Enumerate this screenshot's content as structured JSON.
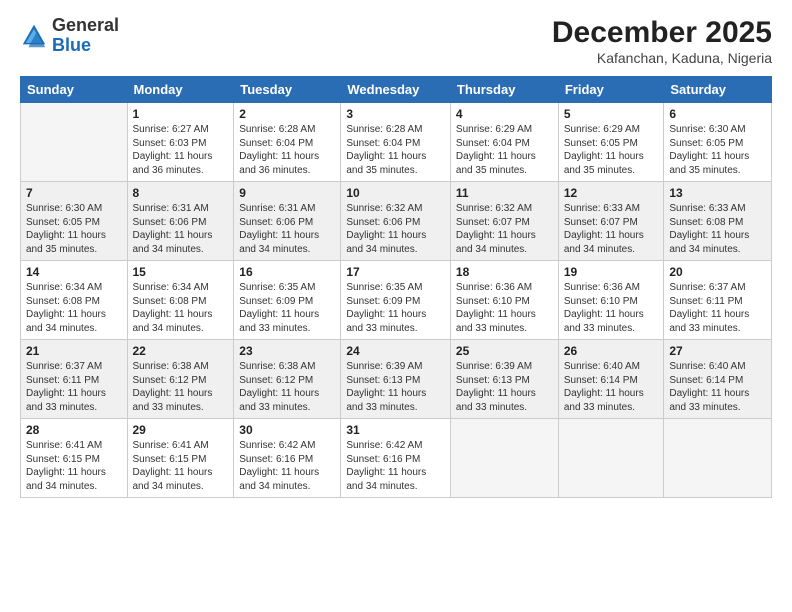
{
  "logo": {
    "general": "General",
    "blue": "Blue"
  },
  "header": {
    "month": "December 2025",
    "location": "Kafanchan, Kaduna, Nigeria"
  },
  "weekdays": [
    "Sunday",
    "Monday",
    "Tuesday",
    "Wednesday",
    "Thursday",
    "Friday",
    "Saturday"
  ],
  "weeks": [
    [
      {
        "day": "",
        "info": ""
      },
      {
        "day": "1",
        "info": "Sunrise: 6:27 AM\nSunset: 6:03 PM\nDaylight: 11 hours\nand 36 minutes."
      },
      {
        "day": "2",
        "info": "Sunrise: 6:28 AM\nSunset: 6:04 PM\nDaylight: 11 hours\nand 36 minutes."
      },
      {
        "day": "3",
        "info": "Sunrise: 6:28 AM\nSunset: 6:04 PM\nDaylight: 11 hours\nand 35 minutes."
      },
      {
        "day": "4",
        "info": "Sunrise: 6:29 AM\nSunset: 6:04 PM\nDaylight: 11 hours\nand 35 minutes."
      },
      {
        "day": "5",
        "info": "Sunrise: 6:29 AM\nSunset: 6:05 PM\nDaylight: 11 hours\nand 35 minutes."
      },
      {
        "day": "6",
        "info": "Sunrise: 6:30 AM\nSunset: 6:05 PM\nDaylight: 11 hours\nand 35 minutes."
      }
    ],
    [
      {
        "day": "7",
        "info": "Sunrise: 6:30 AM\nSunset: 6:05 PM\nDaylight: 11 hours\nand 35 minutes."
      },
      {
        "day": "8",
        "info": "Sunrise: 6:31 AM\nSunset: 6:06 PM\nDaylight: 11 hours\nand 34 minutes."
      },
      {
        "day": "9",
        "info": "Sunrise: 6:31 AM\nSunset: 6:06 PM\nDaylight: 11 hours\nand 34 minutes."
      },
      {
        "day": "10",
        "info": "Sunrise: 6:32 AM\nSunset: 6:06 PM\nDaylight: 11 hours\nand 34 minutes."
      },
      {
        "day": "11",
        "info": "Sunrise: 6:32 AM\nSunset: 6:07 PM\nDaylight: 11 hours\nand 34 minutes."
      },
      {
        "day": "12",
        "info": "Sunrise: 6:33 AM\nSunset: 6:07 PM\nDaylight: 11 hours\nand 34 minutes."
      },
      {
        "day": "13",
        "info": "Sunrise: 6:33 AM\nSunset: 6:08 PM\nDaylight: 11 hours\nand 34 minutes."
      }
    ],
    [
      {
        "day": "14",
        "info": "Sunrise: 6:34 AM\nSunset: 6:08 PM\nDaylight: 11 hours\nand 34 minutes."
      },
      {
        "day": "15",
        "info": "Sunrise: 6:34 AM\nSunset: 6:08 PM\nDaylight: 11 hours\nand 34 minutes."
      },
      {
        "day": "16",
        "info": "Sunrise: 6:35 AM\nSunset: 6:09 PM\nDaylight: 11 hours\nand 33 minutes."
      },
      {
        "day": "17",
        "info": "Sunrise: 6:35 AM\nSunset: 6:09 PM\nDaylight: 11 hours\nand 33 minutes."
      },
      {
        "day": "18",
        "info": "Sunrise: 6:36 AM\nSunset: 6:10 PM\nDaylight: 11 hours\nand 33 minutes."
      },
      {
        "day": "19",
        "info": "Sunrise: 6:36 AM\nSunset: 6:10 PM\nDaylight: 11 hours\nand 33 minutes."
      },
      {
        "day": "20",
        "info": "Sunrise: 6:37 AM\nSunset: 6:11 PM\nDaylight: 11 hours\nand 33 minutes."
      }
    ],
    [
      {
        "day": "21",
        "info": "Sunrise: 6:37 AM\nSunset: 6:11 PM\nDaylight: 11 hours\nand 33 minutes."
      },
      {
        "day": "22",
        "info": "Sunrise: 6:38 AM\nSunset: 6:12 PM\nDaylight: 11 hours\nand 33 minutes."
      },
      {
        "day": "23",
        "info": "Sunrise: 6:38 AM\nSunset: 6:12 PM\nDaylight: 11 hours\nand 33 minutes."
      },
      {
        "day": "24",
        "info": "Sunrise: 6:39 AM\nSunset: 6:13 PM\nDaylight: 11 hours\nand 33 minutes."
      },
      {
        "day": "25",
        "info": "Sunrise: 6:39 AM\nSunset: 6:13 PM\nDaylight: 11 hours\nand 33 minutes."
      },
      {
        "day": "26",
        "info": "Sunrise: 6:40 AM\nSunset: 6:14 PM\nDaylight: 11 hours\nand 33 minutes."
      },
      {
        "day": "27",
        "info": "Sunrise: 6:40 AM\nSunset: 6:14 PM\nDaylight: 11 hours\nand 33 minutes."
      }
    ],
    [
      {
        "day": "28",
        "info": "Sunrise: 6:41 AM\nSunset: 6:15 PM\nDaylight: 11 hours\nand 34 minutes."
      },
      {
        "day": "29",
        "info": "Sunrise: 6:41 AM\nSunset: 6:15 PM\nDaylight: 11 hours\nand 34 minutes."
      },
      {
        "day": "30",
        "info": "Sunrise: 6:42 AM\nSunset: 6:16 PM\nDaylight: 11 hours\nand 34 minutes."
      },
      {
        "day": "31",
        "info": "Sunrise: 6:42 AM\nSunset: 6:16 PM\nDaylight: 11 hours\nand 34 minutes."
      },
      {
        "day": "",
        "info": ""
      },
      {
        "day": "",
        "info": ""
      },
      {
        "day": "",
        "info": ""
      }
    ]
  ]
}
